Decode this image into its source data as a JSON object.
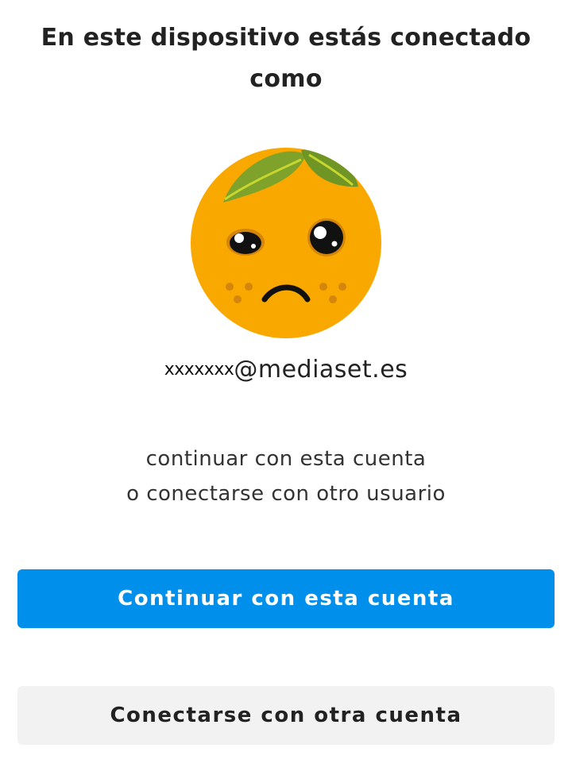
{
  "header": {
    "title_line1": "En este dispositivo estás conectado",
    "title_line2": "como"
  },
  "profile": {
    "avatar_icon": "sad-orange-avatar-icon",
    "email_user": "xxxxxxx",
    "email_domain": "@mediaset.es"
  },
  "message": {
    "line1": "continuar con esta cuenta",
    "line2": "o conectarse con otro usuario"
  },
  "actions": {
    "continue_label": "Continuar con esta cuenta",
    "switch_label": "Conectarse con otra cuenta"
  },
  "colors": {
    "primary": "#008fea",
    "secondary_bg": "#f2f2f2",
    "avatar_orange": "#f9a800",
    "leaf_green": "#7ea22a"
  }
}
